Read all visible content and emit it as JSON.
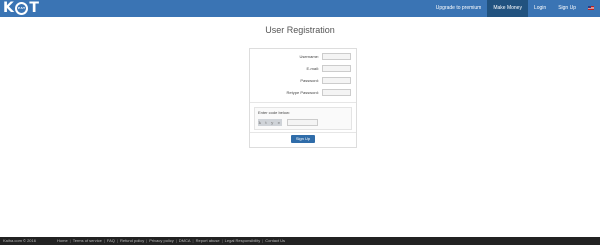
{
  "header": {
    "logo_text_left": "K",
    "logo_text_right": "T",
    "nav": [
      {
        "label": "Upgrade to premium"
      },
      {
        "label": "Make Money"
      },
      {
        "label": "Login"
      },
      {
        "label": "Sign Up"
      }
    ],
    "active_nav": "Make Money",
    "flag_icon": "us-flag-icon"
  },
  "page": {
    "title": "User Registration"
  },
  "form": {
    "fields": [
      {
        "label": "Username:",
        "value": ""
      },
      {
        "label": "E-mail:",
        "value": ""
      },
      {
        "label": "Password:",
        "value": ""
      },
      {
        "label": "Retype Password:",
        "value": ""
      }
    ],
    "captcha_label": "Enter code below:",
    "captcha_code": "k t y e",
    "captcha_value": "",
    "submit_label": "Sign Up"
  },
  "footer": {
    "copyright": "Kaiha.com © 2016",
    "links": [
      "Home",
      "Terms of service",
      "FAQ",
      "Refund policy",
      "Privacy policy",
      "DMCA",
      "Report abuse",
      "Legal Responsibility",
      "Contact Us"
    ]
  },
  "colors": {
    "header_bg": "#3a74b4",
    "active_nav_bg": "#21527f",
    "button_bg": "#2f6ca9",
    "footer_bg": "#222222"
  }
}
